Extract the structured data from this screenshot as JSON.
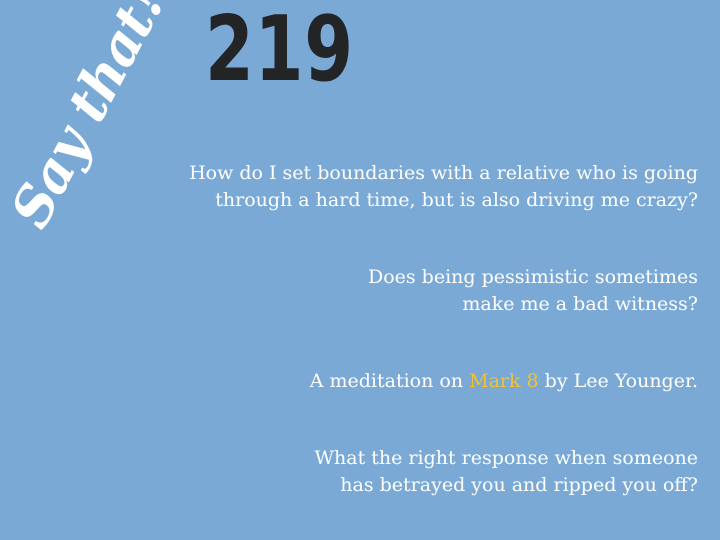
{
  "logo_text": "Say that!",
  "episode_number": "219",
  "colors": {
    "background": "#7aa9d6",
    "number": "#222426",
    "text": "#ffffff",
    "highlight": "#f2c230"
  },
  "topics": [
    {
      "line1": "How do I set boundaries with a relative who is going",
      "line2": "through a hard time, but is also driving me crazy?"
    },
    {
      "line1": "Does being pessimistic sometimes",
      "line2": "make me a bad witness?"
    },
    {
      "prefix": "A meditation on ",
      "highlight": "Mark 8",
      "suffix": " by Lee Younger."
    },
    {
      "line1": "What the right response when someone",
      "line2": "has betrayed you and ripped you off?"
    }
  ]
}
